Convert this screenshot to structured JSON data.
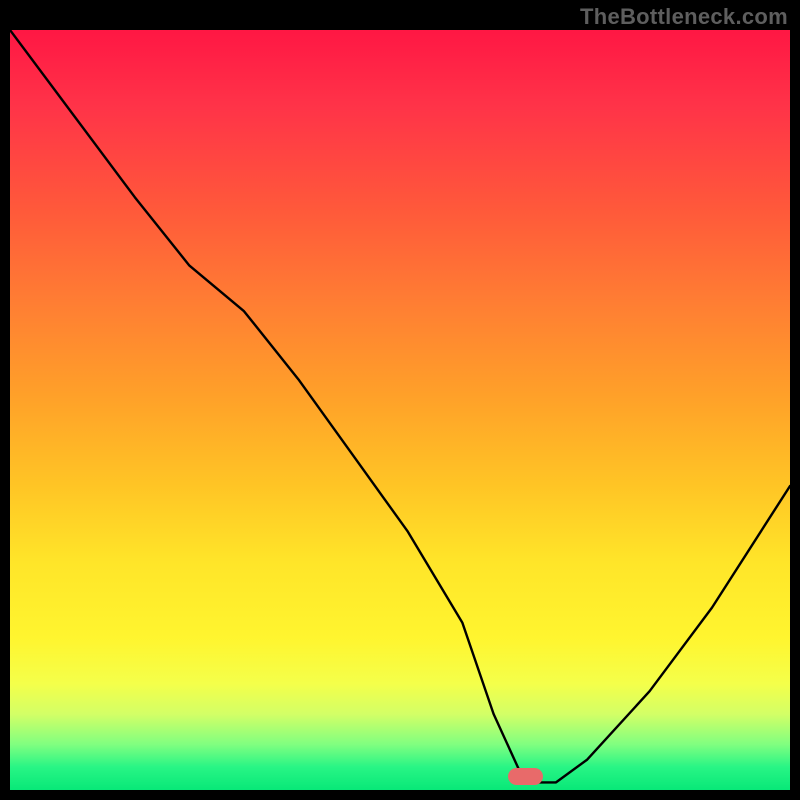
{
  "watermark": "TheBottleneck.com",
  "marker": {
    "x_pct": 66,
    "y_pct": 98.2
  },
  "chart_data": {
    "type": "line",
    "title": "",
    "xlabel": "",
    "ylabel": "",
    "xlim": [
      0,
      100
    ],
    "ylim": [
      0,
      100
    ],
    "grid": false,
    "series": [
      {
        "name": "bottleneck-curve",
        "x": [
          0,
          8,
          16,
          23,
          30,
          37,
          44,
          51,
          58,
          62,
          66,
          70,
          74,
          82,
          90,
          100
        ],
        "y": [
          100,
          89,
          78,
          69,
          63,
          54,
          44,
          34,
          22,
          10,
          1,
          1,
          4,
          13,
          24,
          40
        ]
      }
    ],
    "marker_point": {
      "x": 66,
      "y": 1
    },
    "background_gradient": {
      "top": "#ff1744",
      "mid": "#ffe529",
      "bottom": "#08e878"
    }
  }
}
